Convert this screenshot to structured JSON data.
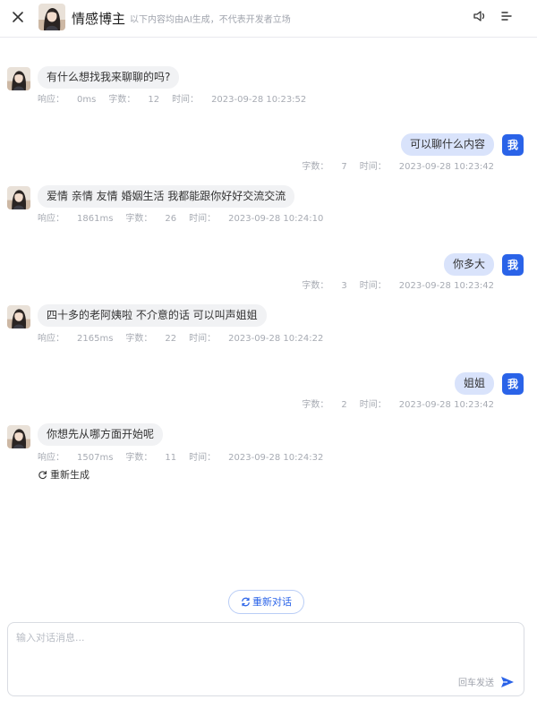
{
  "header": {
    "close_icon": "close-icon",
    "title": "情感博主",
    "subtitle": "以下内容均由AI生成，不代表开发者立场",
    "speaker_icon": "speaker-icon",
    "menu_icon": "menu-icon"
  },
  "labels": {
    "response": "响应：",
    "chars": "字数：",
    "time": "时间：",
    "me": "我"
  },
  "messages": [
    {
      "role": "assistant",
      "text": "有什么想找我来聊聊的吗?",
      "response": "0ms",
      "chars": "12",
      "time": "2023-09-28 10:23:52"
    },
    {
      "role": "user",
      "text": "可以聊什么内容",
      "chars": "7",
      "time": "2023-09-28 10:23:42"
    },
    {
      "role": "assistant",
      "text": "爱情 亲情 友情 婚姻生活 我都能跟你好好交流交流",
      "response": "1861ms",
      "chars": "26",
      "time": "2023-09-28 10:24:10"
    },
    {
      "role": "user",
      "text": "你多大",
      "chars": "3",
      "time": "2023-09-28 10:23:42"
    },
    {
      "role": "assistant",
      "text": "四十多的老阿姨啦 不介意的话 可以叫声姐姐",
      "response": "2165ms",
      "chars": "22",
      "time": "2023-09-28 10:24:22"
    },
    {
      "role": "user",
      "text": "姐姐",
      "chars": "2",
      "time": "2023-09-28 10:23:42"
    },
    {
      "role": "assistant",
      "text": "你想先从哪方面开始呢",
      "response": "1507ms",
      "chars": "11",
      "time": "2023-09-28 10:24:32"
    }
  ],
  "regenerate_label": "重新生成",
  "restart_label": "重新对话",
  "input": {
    "placeholder": "输入对话消息...",
    "value": "",
    "send_hint": "回车发送"
  },
  "colors": {
    "accent": "#2a63e8",
    "user_bubble": "#d9e3fb",
    "assistant_bubble": "#f1f2f4"
  }
}
